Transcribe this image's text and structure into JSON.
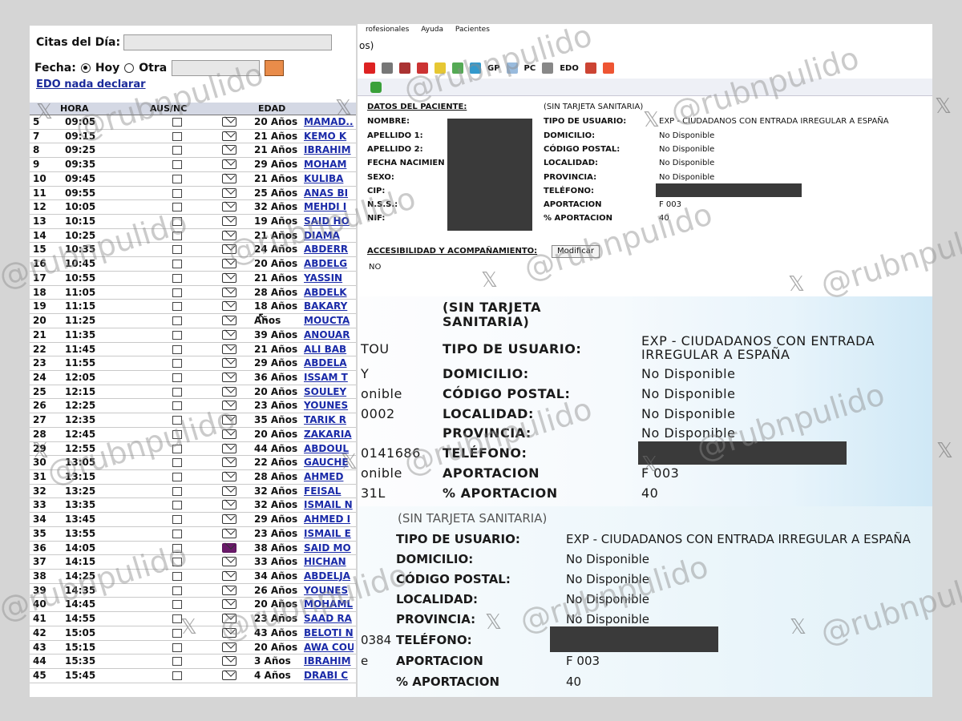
{
  "left_panel": {
    "citas_label": "Citas del Día:",
    "fecha_label": "Fecha:",
    "radio_hoy": "Hoy",
    "radio_otra": "Otra",
    "edo_link": "EDO nada declarar",
    "headers": {
      "hora": "HORA",
      "aus": "AUS/NC",
      "edad": "EDAD"
    },
    "rows": [
      {
        "n": "5",
        "hora": "09:05",
        "edad": "20 Años",
        "nombre": "MAMAD..."
      },
      {
        "n": "7",
        "hora": "09:15",
        "edad": "21 Años",
        "nombre": "KEMO K"
      },
      {
        "n": "8",
        "hora": "09:25",
        "edad": "21 Años",
        "nombre": "IBRAHIM"
      },
      {
        "n": "9",
        "hora": "09:35",
        "edad": "29 Años",
        "nombre": "MOHAM"
      },
      {
        "n": "10",
        "hora": "09:45",
        "edad": "21 Años",
        "nombre": "KULIBA"
      },
      {
        "n": "11",
        "hora": "09:55",
        "edad": "25 Años",
        "nombre": "ANAS BI"
      },
      {
        "n": "12",
        "hora": "10:05",
        "edad": "32 Años",
        "nombre": "MEHDI I"
      },
      {
        "n": "13",
        "hora": "10:15",
        "edad": "19 Años",
        "nombre": "SAID HO"
      },
      {
        "n": "14",
        "hora": "10:25",
        "edad": "21 Años",
        "nombre": "DIAMA"
      },
      {
        "n": "15",
        "hora": "10:35",
        "edad": "24 Años",
        "nombre": "ABDERR"
      },
      {
        "n": "16",
        "hora": "10:45",
        "edad": "20 Años",
        "nombre": "ABDELG"
      },
      {
        "n": "17",
        "hora": "10:55",
        "edad": "21 Años",
        "nombre": "YASSIN"
      },
      {
        "n": "18",
        "hora": "11:05",
        "edad": "28 Años",
        "nombre": "ABDELK"
      },
      {
        "n": "19",
        "hora": "11:15",
        "edad": "18 Años",
        "nombre": "BAKARY"
      },
      {
        "n": "20",
        "hora": "11:25",
        "edad": "Años",
        "nombre": "MOUCTA"
      },
      {
        "n": "21",
        "hora": "11:35",
        "edad": "39 Años",
        "nombre": "ANOUAR"
      },
      {
        "n": "22",
        "hora": "11:45",
        "edad": "21 Años",
        "nombre": "ALI BAB"
      },
      {
        "n": "23",
        "hora": "11:55",
        "edad": "29 Años",
        "nombre": "ABDELA"
      },
      {
        "n": "24",
        "hora": "12:05",
        "edad": "36 Años",
        "nombre": "ISSAM T"
      },
      {
        "n": "25",
        "hora": "12:15",
        "edad": "20 Años",
        "nombre": "SOULEY"
      },
      {
        "n": "26",
        "hora": "12:25",
        "edad": "23 Años",
        "nombre": "YOUNES"
      },
      {
        "n": "27",
        "hora": "12:35",
        "edad": "35 Años",
        "nombre": "TARIK R"
      },
      {
        "n": "28",
        "hora": "12:45",
        "edad": "20 Años",
        "nombre": "ZAKARIA"
      },
      {
        "n": "29",
        "hora": "12:55",
        "edad": "44 Años",
        "nombre": "ABDOUL"
      },
      {
        "n": "30",
        "hora": "13:05",
        "edad": "22 Años",
        "nombre": "GAUCHE"
      },
      {
        "n": "31",
        "hora": "13:15",
        "edad": "28 Años",
        "nombre": "AHMED"
      },
      {
        "n": "32",
        "hora": "13:25",
        "edad": "32 Años",
        "nombre": "FEISAL"
      },
      {
        "n": "33",
        "hora": "13:35",
        "edad": "32 Años",
        "nombre": "ISMAIL N"
      },
      {
        "n": "34",
        "hora": "13:45",
        "edad": "29 Años",
        "nombre": "AHMED I"
      },
      {
        "n": "35",
        "hora": "13:55",
        "edad": "23 Años",
        "nombre": "ISMAIL E"
      },
      {
        "n": "36",
        "hora": "14:05",
        "edad": "38 Años",
        "nombre": "SAID MO"
      },
      {
        "n": "37",
        "hora": "14:15",
        "edad": "33 Años",
        "nombre": "HICHAN"
      },
      {
        "n": "38",
        "hora": "14:25",
        "edad": "34 Años",
        "nombre": "ABDELJA"
      },
      {
        "n": "39",
        "hora": "14:35",
        "edad": "26 Años",
        "nombre": "YOUNES"
      },
      {
        "n": "40",
        "hora": "14:45",
        "edad": "20 Años",
        "nombre": "MOHAML"
      },
      {
        "n": "41",
        "hora": "14:55",
        "edad": "23 Años",
        "nombre": "SAAD RA"
      },
      {
        "n": "42",
        "hora": "15:05",
        "edad": "43 Años",
        "nombre": "BELOTI N"
      },
      {
        "n": "43",
        "hora": "15:15",
        "edad": "20 Años",
        "nombre": "AWA COU"
      },
      {
        "n": "44",
        "hora": "15:35",
        "edad": "3 Años",
        "nombre": "IBRAHIM"
      },
      {
        "n": "45",
        "hora": "15:45",
        "edad": "4 Años",
        "nombre": "DRABI C"
      }
    ]
  },
  "right_top": {
    "menu": [
      "rofesionales",
      "Ayuda",
      "Pacientes"
    ],
    "path": "os)",
    "toolbar": [
      "GP",
      "PC",
      "EDO"
    ],
    "datos_title": "DATOS DEL PACIENTE:",
    "sin_tarjeta": "(SIN TARJETA SANITARIA)",
    "left_labels": [
      "NOMBRE:",
      "APELLIDO 1:",
      "APELLIDO 2:",
      "FECHA NACIMIEN",
      "SEXO:",
      "CIP:",
      "N.S.S.:",
      "NIF:"
    ],
    "right_labels": [
      "TIPO DE USUARIO:",
      "DOMICILIO:",
      "CÓDIGO POSTAL:",
      "LOCALIDAD:",
      "PROVINCIA:",
      "TELÉFONO:",
      "APORTACION",
      "% APORTACION"
    ],
    "right_values": [
      "EXP - CIUDADANOS CON ENTRADA IRREGULAR A ESPAÑA",
      "No Disponible",
      "No Disponible",
      "No Disponible",
      "No Disponible",
      "",
      "F 003",
      "40"
    ],
    "acces_label": "ACCESIBILIDAD Y ACOMPAÑAMIENTO:",
    "modificar": "Modificar",
    "acces_value": "NO"
  },
  "right_mid": {
    "sin1": "(SIN TARJETA",
    "sin2": "SANITARIA)",
    "left_fragments": [
      "TOU",
      "Y",
      "onible",
      "0002",
      "",
      "0141686",
      "onible",
      "31L"
    ],
    "labels": [
      "TIPO DE USUARIO:",
      "DOMICILIO:",
      "CÓDIGO POSTAL:",
      "LOCALIDAD:",
      "PROVINCIA:",
      "TELÉFONO:",
      "APORTACION",
      "% APORTACION"
    ],
    "tipo1": "EXP - CIUDADANOS CON ENTRADA",
    "tipo2": "IRREGULAR A ESPAÑA",
    "values": [
      "No Disponible",
      "No Disponible",
      "No Disponible",
      "No Disponible",
      "",
      "F 003",
      "40"
    ]
  },
  "right_bot": {
    "sin": "(SIN TARJETA SANITARIA)",
    "left_fragments": [
      "0384",
      "e"
    ],
    "labels": [
      "TIPO DE USUARIO:",
      "DOMICILIO:",
      "CÓDIGO POSTAL:",
      "LOCALIDAD:",
      "PROVINCIA:",
      "TELÉFONO:",
      "APORTACION",
      "% APORTACION"
    ],
    "values": [
      "EXP - CIUDADANOS CON ENTRADA IRREGULAR A ESPAÑA",
      "No Disponible",
      "No Disponible",
      "No Disponible",
      "No Disponible",
      "",
      "F 003",
      "40"
    ]
  },
  "watermark": "@rubnpulido",
  "x_logo": "𝕏"
}
